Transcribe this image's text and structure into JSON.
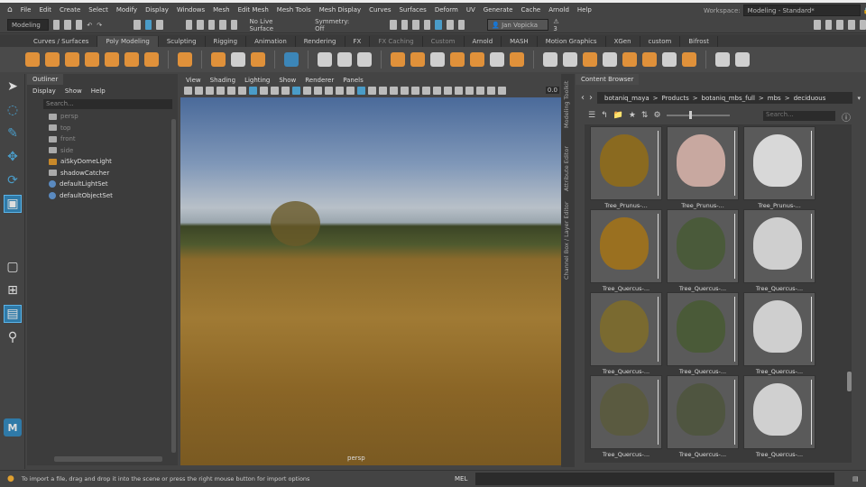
{
  "menu": [
    "File",
    "Edit",
    "Create",
    "Select",
    "Modify",
    "Display",
    "Windows",
    "Mesh",
    "Edit Mesh",
    "Mesh Tools",
    "Mesh Display",
    "Curves",
    "Surfaces",
    "Deform",
    "UV",
    "Generate",
    "Cache",
    "Arnold",
    "Help"
  ],
  "workspace_label": "Workspace:",
  "workspace_value": "Modeling - Standard*",
  "status": {
    "mode": "Modeling",
    "live_surface": "No Live Surface",
    "symmetry": "Symmetry: Off",
    "user": "Jan Vopicka",
    "warnings": "3"
  },
  "shelf_tabs": [
    "Curves / Surfaces",
    "Poly Modeling",
    "Sculpting",
    "Rigging",
    "Animation",
    "Rendering",
    "FX",
    "FX Caching",
    "Custom",
    "Arnold",
    "MASH",
    "Motion Graphics",
    "XGen",
    "custom",
    "Bifrost"
  ],
  "outliner": {
    "tab": "Outliner",
    "menu": [
      "Display",
      "Show",
      "Help"
    ],
    "search_placeholder": "Search...",
    "items": [
      {
        "name": "persp",
        "dim": true
      },
      {
        "name": "top",
        "dim": true
      },
      {
        "name": "front",
        "dim": true
      },
      {
        "name": "side",
        "dim": true
      },
      {
        "name": "aiSkyDomeLight"
      },
      {
        "name": "shadowCatcher"
      },
      {
        "name": "defaultLightSet"
      },
      {
        "name": "defaultObjectSet"
      }
    ]
  },
  "viewport": {
    "menu": [
      "View",
      "Shading",
      "Lighting",
      "Show",
      "Renderer",
      "Panels"
    ],
    "camera": "persp",
    "value": "0.0"
  },
  "side_tabs": [
    "Modeling Toolkit",
    "Attribute Editor",
    "Channel Box / Layer Editor"
  ],
  "content_browser": {
    "tab": "Content Browser",
    "path": [
      "botaniq_maya",
      "Products",
      "botaniq_mbs_full",
      "mbs",
      "deciduous"
    ],
    "search_placeholder": "Search...",
    "items": [
      {
        "label": "Tree_Prunus-...",
        "color": "#8a6a20"
      },
      {
        "label": "Tree_Prunus-...",
        "color": "#c8a8a0"
      },
      {
        "label": "Tree_Prunus-...",
        "color": "#d8d8d8"
      },
      {
        "label": "Tree_Quercus-...",
        "color": "#9a7020"
      },
      {
        "label": "Tree_Quercus-...",
        "color": "#4a5a3a"
      },
      {
        "label": "Tree_Quercus-...",
        "color": "#cfcfcf"
      },
      {
        "label": "Tree_Quercus-...",
        "color": "#7a6a30"
      },
      {
        "label": "Tree_Quercus-...",
        "color": "#4a5a38"
      },
      {
        "label": "Tree_Quercus-...",
        "color": "#cfcfcf"
      },
      {
        "label": "Tree_Quercus-...",
        "color": "#5a5a40"
      },
      {
        "label": "Tree_Quercus-...",
        "color": "#4f5540"
      },
      {
        "label": "Tree_Quercus-...",
        "color": "#d0d0d0"
      }
    ]
  },
  "help_line": "To import a file, drag and drop it into the scene or press the right mouse button for import options",
  "command_line": {
    "label": "MEL"
  }
}
